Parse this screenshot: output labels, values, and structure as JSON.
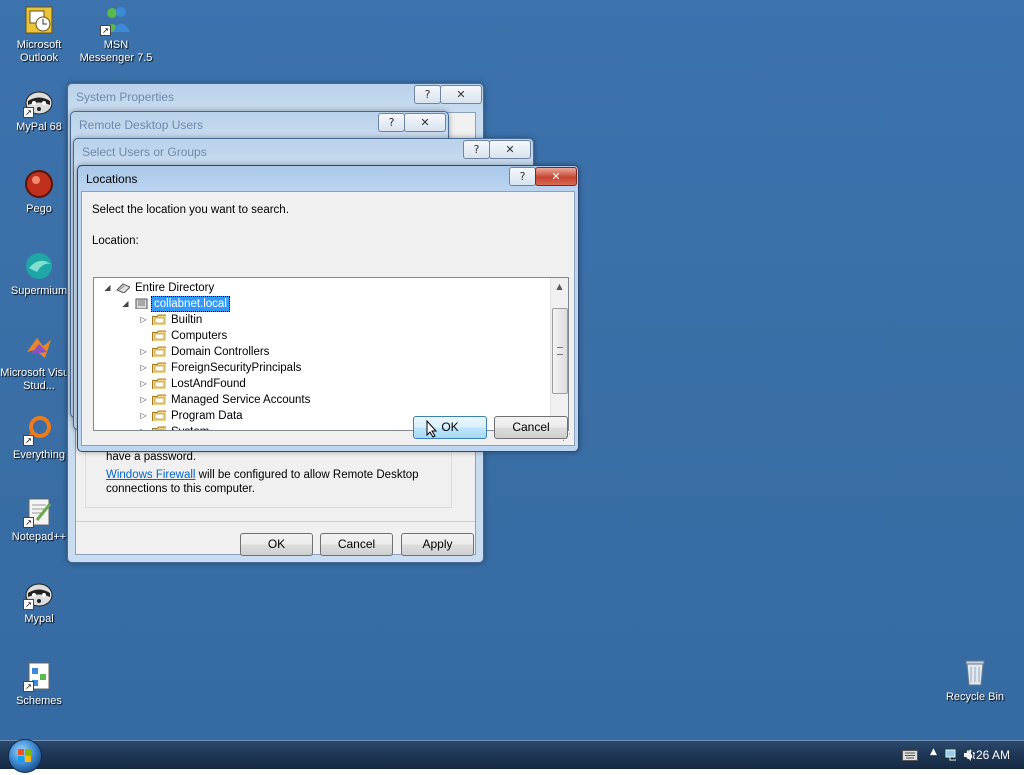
{
  "desktop_icons": [
    {
      "label": "Microsoft Outlook",
      "icon": "outlook-icon"
    },
    {
      "label": "MSN Messenger 7.5",
      "icon": "msn-messenger-icon"
    },
    {
      "label": "MyPal 68",
      "icon": "mypal-icon"
    },
    {
      "label": "Pego",
      "icon": "pego-icon"
    },
    {
      "label": "Supermium",
      "icon": "supermium-icon"
    },
    {
      "label": "Microsoft Visual Stud...",
      "icon": "visual-studio-icon"
    },
    {
      "label": "Everything",
      "icon": "everything-icon"
    },
    {
      "label": "Notepad++",
      "icon": "notepad-plus-plus-icon"
    },
    {
      "label": "Mypal",
      "icon": "mypal-icon"
    },
    {
      "label": "Schemes",
      "icon": "schemes-icon"
    },
    {
      "label": "Recycle Bin",
      "icon": "recycle-bin-icon"
    }
  ],
  "system_properties": {
    "title": "System Properties",
    "text_password": "have a password.",
    "firewall_link": "Windows Firewall",
    "firewall_text": " will be configured to allow Remote Desktop connections to this computer.",
    "ok_label": "OK",
    "cancel_label": "Cancel",
    "apply_label": "Apply"
  },
  "remote_desktop_users": {
    "title": "Remote Desktop Users"
  },
  "select_users": {
    "title": "Select Users or Groups"
  },
  "locations": {
    "title": "Locations",
    "instruction": "Select the location you want to search.",
    "location_label": "Location:",
    "tree": [
      {
        "label": "Entire Directory",
        "level": 0,
        "expander": "open",
        "icon": "directory-icon",
        "selected": false
      },
      {
        "label": "collabnet.local",
        "level": 1,
        "expander": "open",
        "icon": "domain-icon",
        "selected": true
      },
      {
        "label": "Builtin",
        "level": 2,
        "expander": "closed",
        "icon": "folder-icon",
        "selected": false
      },
      {
        "label": "Computers",
        "level": 2,
        "expander": "none",
        "icon": "folder-icon",
        "selected": false
      },
      {
        "label": "Domain Controllers",
        "level": 2,
        "expander": "closed",
        "icon": "folder-icon",
        "selected": false
      },
      {
        "label": "ForeignSecurityPrincipals",
        "level": 2,
        "expander": "closed",
        "icon": "folder-icon",
        "selected": false
      },
      {
        "label": "LostAndFound",
        "level": 2,
        "expander": "closed",
        "icon": "folder-icon",
        "selected": false
      },
      {
        "label": "Managed Service Accounts",
        "level": 2,
        "expander": "closed",
        "icon": "folder-icon",
        "selected": false
      },
      {
        "label": "Program Data",
        "level": 2,
        "expander": "closed",
        "icon": "folder-icon",
        "selected": false
      },
      {
        "label": "System",
        "level": 2,
        "expander": "closed",
        "icon": "folder-icon",
        "selected": false
      }
    ],
    "ok_label": "OK",
    "cancel_label": "Cancel"
  },
  "taskbar": {
    "clock": "5:26 AM",
    "tray_icons": [
      "keyboard-icon",
      "show-hidden-icons-chevron",
      "network-icon",
      "volume-icon"
    ]
  },
  "colors": {
    "desktop_background": "#3a6ea5",
    "selection": "#3399ff",
    "close_button": "#c8452f"
  }
}
